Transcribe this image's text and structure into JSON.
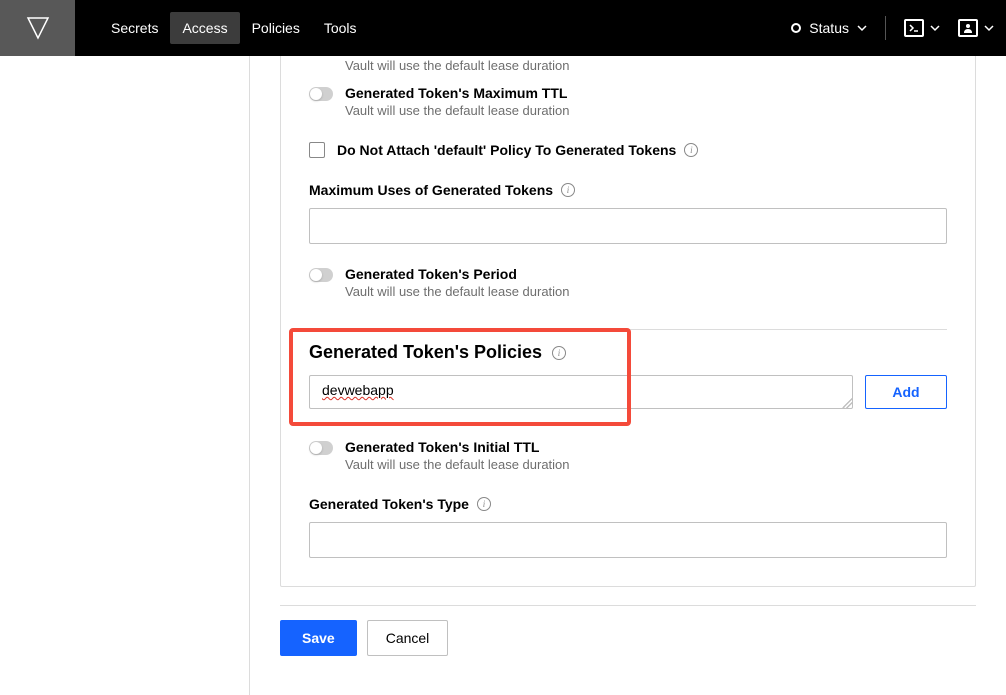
{
  "header": {
    "nav": [
      "Secrets",
      "Access",
      "Policies",
      "Tools"
    ],
    "active_nav": "Access",
    "status_label": "Status"
  },
  "partial_hint": "Vault will use the default lease duration",
  "toggle_max_ttl": {
    "label": "Generated Token's Maximum TTL",
    "sub": "Vault will use the default lease duration"
  },
  "checkbox_nodefault": {
    "label": "Do Not Attach 'default' Policy To Generated Tokens"
  },
  "max_uses": {
    "label": "Maximum Uses of Generated Tokens",
    "value": ""
  },
  "toggle_period": {
    "label": "Generated Token's Period",
    "sub": "Vault will use the default lease duration"
  },
  "policies": {
    "header": "Generated Token's Policies",
    "value": "devwebapp",
    "add_label": "Add"
  },
  "toggle_initial_ttl": {
    "label": "Generated Token's Initial TTL",
    "sub": "Vault will use the default lease duration"
  },
  "token_type": {
    "label": "Generated Token's Type",
    "value": ""
  },
  "actions": {
    "save": "Save",
    "cancel": "Cancel"
  }
}
